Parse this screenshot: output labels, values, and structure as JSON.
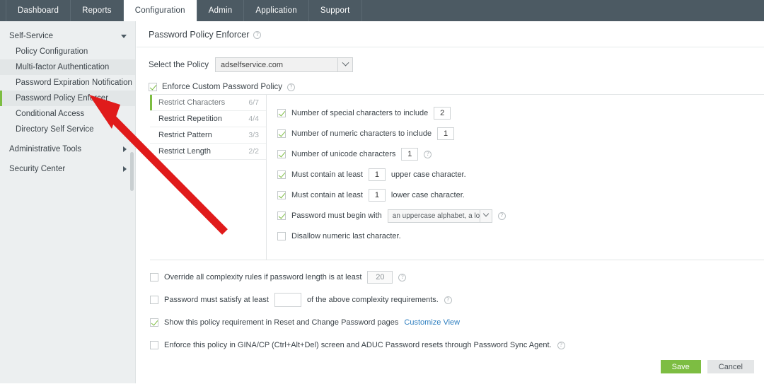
{
  "topnav": {
    "tabs": [
      {
        "label": "Dashboard",
        "active": false
      },
      {
        "label": "Reports",
        "active": false
      },
      {
        "label": "Configuration",
        "active": true
      },
      {
        "label": "Admin",
        "active": false
      },
      {
        "label": "Application",
        "active": false
      },
      {
        "label": "Support",
        "active": false
      }
    ]
  },
  "sidebar": {
    "group_self_service": "Self-Service",
    "items": [
      {
        "label": "Policy Configuration"
      },
      {
        "label": "Multi-factor Authentication"
      },
      {
        "label": "Password Expiration Notification"
      },
      {
        "label": "Password Policy Enforcer"
      },
      {
        "label": "Conditional Access"
      },
      {
        "label": "Directory Self Service"
      }
    ],
    "group_admin_tools": "Administrative Tools",
    "group_security_center": "Security Center"
  },
  "page": {
    "title": "Password Policy Enforcer",
    "help": "?"
  },
  "policy_select": {
    "label": "Select the Policy",
    "value": "adselfservice.com"
  },
  "enforce_custom": {
    "label": "Enforce Custom Password Policy",
    "checked": true
  },
  "restrict_tabs": [
    {
      "label": "Restrict Characters",
      "count": "6/7",
      "active": true
    },
    {
      "label": "Restrict Repetition",
      "count": "4/4",
      "active": false
    },
    {
      "label": "Restrict Pattern",
      "count": "3/3",
      "active": false
    },
    {
      "label": "Restrict Length",
      "count": "2/2",
      "active": false
    }
  ],
  "rules": {
    "special": {
      "label": "Number of special characters to include",
      "value": "2",
      "checked": true
    },
    "numeric": {
      "label": "Number of numeric characters to include",
      "value": "1",
      "checked": true
    },
    "unicode": {
      "label": "Number of unicode characters",
      "value": "1",
      "checked": true
    },
    "upper": {
      "label_pre": "Must contain at least",
      "value": "1",
      "label_post": "upper case character.",
      "checked": true
    },
    "lower": {
      "label_pre": "Must contain at least",
      "value": "1",
      "label_post": "lower case character.",
      "checked": true
    },
    "beginwith": {
      "label": "Password must begin with",
      "value": "an uppercase alphabet, a lowe",
      "checked": true
    },
    "disallow_numeric_last": {
      "label": "Disallow numeric last character.",
      "checked": false
    }
  },
  "options": {
    "override": {
      "label_pre": "Override all complexity rules if password length is at least",
      "value": "20",
      "checked": false
    },
    "satisfy": {
      "label_pre": "Password must satisfy at least",
      "value": "",
      "label_post": "of the above complexity requirements.",
      "checked": false
    },
    "show_policy": {
      "label": "Show this policy requirement in Reset and Change Password pages",
      "link": "Customize View",
      "checked": true
    },
    "gina": {
      "label": "Enforce this policy in GINA/CP (Ctrl+Alt+Del) screen and ADUC Password resets through Password Sync Agent.",
      "checked": false
    }
  },
  "buttons": {
    "save": "Save",
    "cancel": "Cancel"
  },
  "colors": {
    "nav_bg": "#4c5a63",
    "accent_green": "#7dbd42",
    "link_blue": "#2f7fc0",
    "sidebar_bg": "#eceff0",
    "annotation_red": "#e01b1b"
  }
}
